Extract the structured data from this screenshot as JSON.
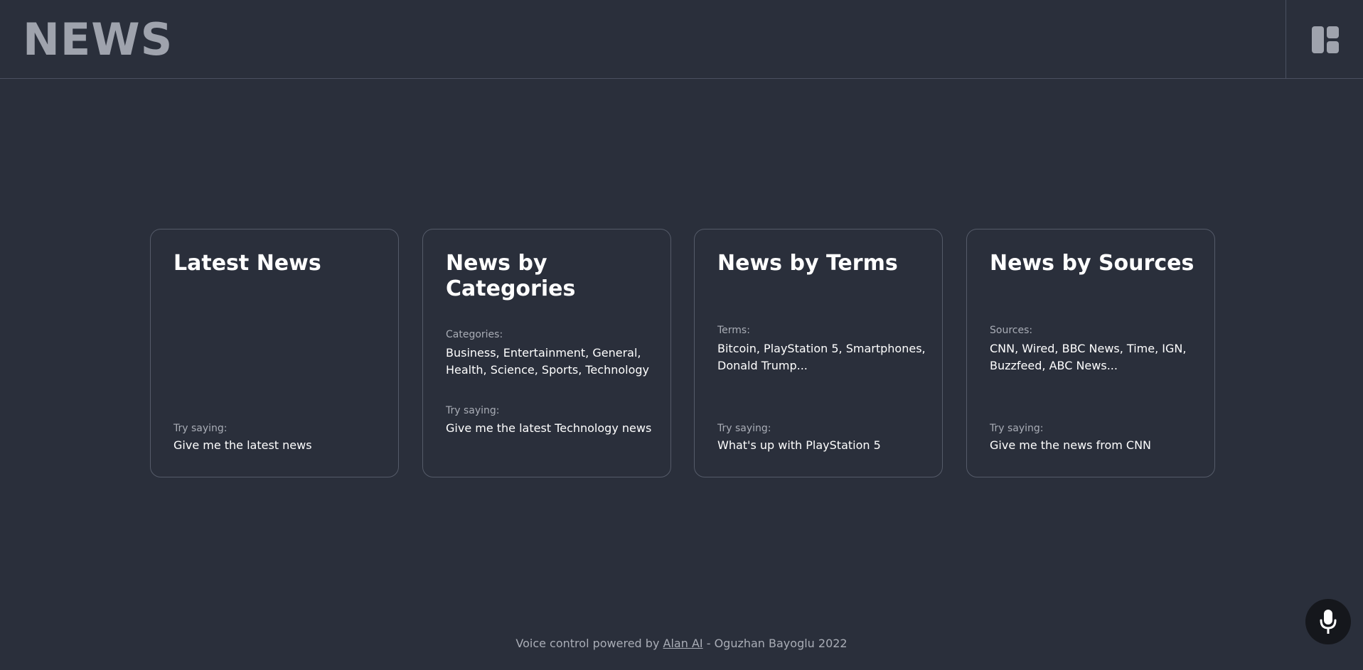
{
  "header": {
    "logo": "NEWS",
    "layout_icon": "layout-grid-icon"
  },
  "cards": [
    {
      "title": "Latest News",
      "info_label": "",
      "info_value": "",
      "try_label": "Try saying:",
      "try_value": "Give me the latest news"
    },
    {
      "title": "News by Categories",
      "info_label": "Categories:",
      "info_value": "Business, Entertainment, General, Health, Science, Sports, Technology",
      "try_label": "Try saying:",
      "try_value": "Give me the latest Technology news"
    },
    {
      "title": "News by Terms",
      "info_label": "Terms:",
      "info_value": "Bitcoin, PlayStation 5, Smartphones, Donald Trump...",
      "try_label": "Try saying:",
      "try_value": "What's up with PlayStation 5"
    },
    {
      "title": "News by Sources",
      "info_label": "Sources:",
      "info_value": "CNN, Wired, BBC News, Time, IGN, Buzzfeed, ABC News...",
      "try_label": "Try saying:",
      "try_value": "Give me the news from CNN"
    }
  ],
  "mic": {
    "icon": "microphone-icon"
  },
  "footer": {
    "prefix": "Voice control powered by",
    "link": "Alan AI",
    "suffix": "- Oguzhan Bayoglu 2022"
  },
  "colors": {
    "background": "#2a2f3b",
    "logo": "#9fa3ad",
    "card_border": "#555b69",
    "muted_text": "#a9adb6",
    "mic_button": "#15171c"
  }
}
